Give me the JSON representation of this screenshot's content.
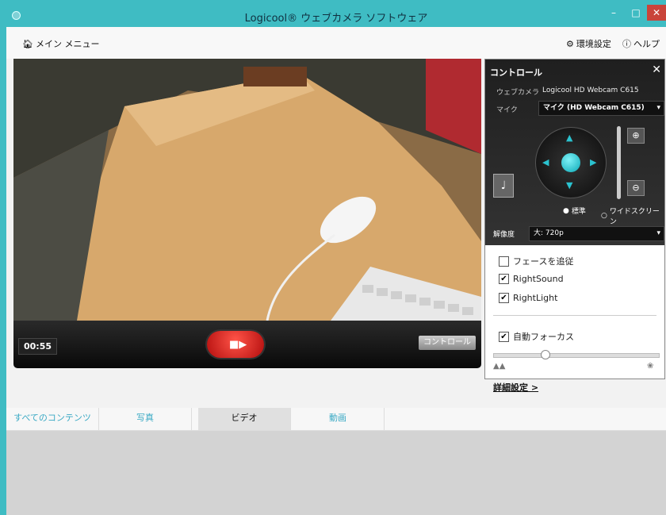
{
  "window": {
    "title": "Logicool® ウェブカメラ ソフトウェア",
    "minimize": "–",
    "maximize": "□",
    "close": "✕"
  },
  "menubar": {
    "home_label": "メイン メニュー",
    "settings_label": "環境設定",
    "help_label": "ヘルプ"
  },
  "video": {
    "elapsed": "00:55",
    "controls_button": "コントロール"
  },
  "controls": {
    "title": "コントロール",
    "webcam_label": "ウェブカメラ",
    "webcam_value": "Logicool HD Webcam C615",
    "mic_label": "マイク",
    "mic_value": "マイク (HD Webcam C615)",
    "aspect_standard": "標準",
    "aspect_wide": "ワイドスクリーン",
    "aspect_selected": "標準",
    "resolution_label": "解像度",
    "resolution_value": "大: 720p",
    "face_tracking": "フェースを追従",
    "face_tracking_checked": false,
    "right_sound": "RightSound",
    "right_sound_checked": true,
    "right_light": "RightLight",
    "right_light_checked": true,
    "autofocus": "自動フォーカス",
    "autofocus_checked": true,
    "focus_level": 0.3,
    "advanced_link": "詳細設定 >"
  },
  "tabs": [
    {
      "label": "すべてのコンテンツ"
    },
    {
      "label": "写真"
    },
    {
      "label": "ビデオ"
    },
    {
      "label": "動画"
    }
  ],
  "active_tab": "ビデオ",
  "colors": {
    "accent": "#3fbcc3",
    "record": "#d81b1b",
    "tab_text": "#3aa9c4"
  }
}
